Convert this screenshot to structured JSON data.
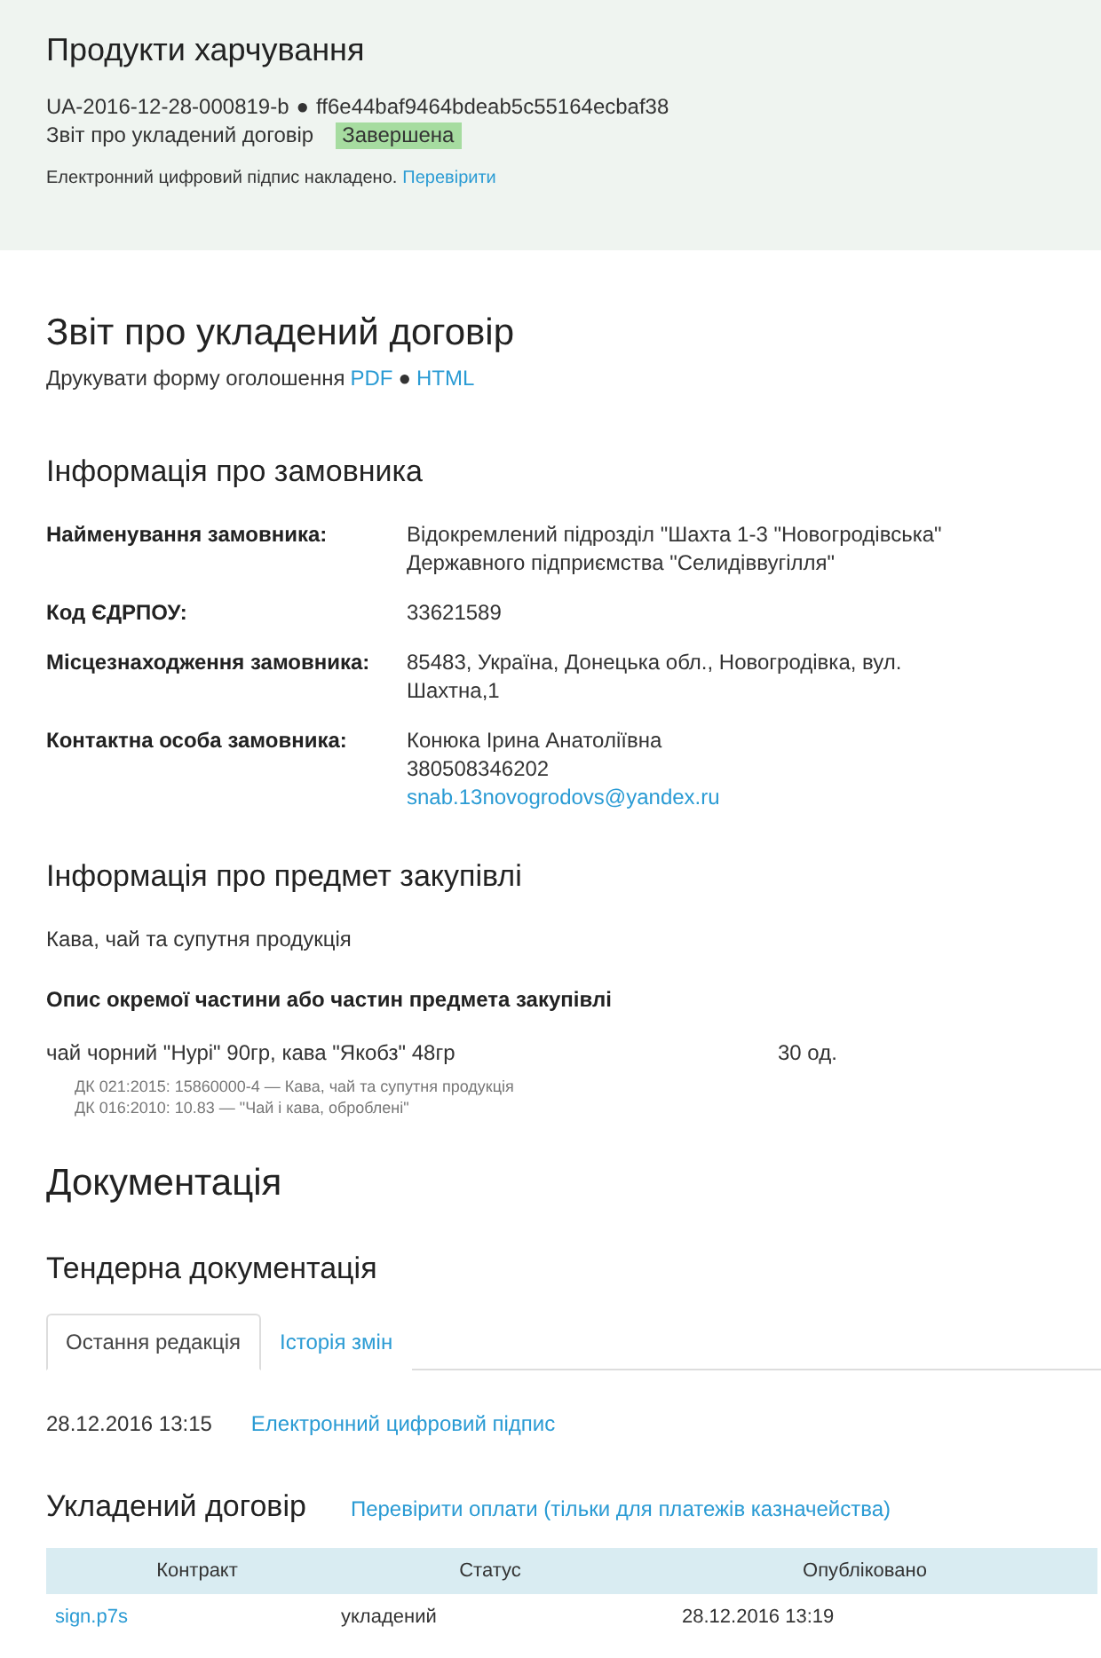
{
  "header": {
    "title": "Продукти харчування",
    "id": "UA-2016-12-28-000819-b",
    "separator": "●",
    "hash": "ff6e44baf9464bdeab5c55164ecbaf38",
    "type": "Звіт про укладений договір",
    "status": "Завершена",
    "signature_note": "Електронний цифровий підпис накладено.",
    "signature_link": "Перевірити"
  },
  "report": {
    "title": "Звіт про укладений договір",
    "print_label": "Друкувати форму оголошення",
    "print_links": [
      "PDF",
      "HTML"
    ],
    "separator": "●"
  },
  "customer": {
    "title": "Інформація про замовника",
    "rows": [
      {
        "label": "Найменування замовника:",
        "lines": [
          {
            "text": "Відокремлений підрозділ \"Шахта 1-3 \"Новогродівська\"",
            "kind": "text"
          },
          {
            "text": "Державного підприємства \"Селидіввугілля\"",
            "kind": "text"
          }
        ]
      },
      {
        "label": "Код ЄДРПОУ:",
        "lines": [
          {
            "text": "33621589",
            "kind": "text"
          }
        ]
      },
      {
        "label": "Місцезнаходження замовника:",
        "lines": [
          {
            "text": "85483, Україна, Донецька обл., Новогродівка, вул.",
            "kind": "text"
          },
          {
            "text": "Шахтна,1",
            "kind": "text"
          }
        ]
      },
      {
        "label": "Контактна особа замовника:",
        "lines": [
          {
            "text": "Конюка Ірина Анатоліївна",
            "kind": "text"
          },
          {
            "text": "380508346202",
            "kind": "text"
          },
          {
            "text": "snab.13novogrodovs@yandex.ru",
            "kind": "link"
          }
        ]
      }
    ]
  },
  "subject": {
    "title": "Інформація про предмет закупівлі",
    "description": "Кава, чай та супутня продукція",
    "lots_title": "Опис окремої частини або частин предмета закупівлі",
    "items": [
      {
        "name": "чай чорний \"Нурі\" 90гр, кава \"Якобз\" 48гр",
        "quantity": "30 од.",
        "codes": [
          "ДК 021:2015: 15860000-4 — Кава, чай та супутня продукція",
          "ДК 016:2010: 10.83 — \"Чай і кава, оброблені\""
        ]
      }
    ]
  },
  "documentation": {
    "title": "Документація",
    "tender_title": "Тендерна документація",
    "tabs": [
      {
        "label": "Остання редакція",
        "selected": true
      },
      {
        "label": "Історія змін",
        "selected": false
      }
    ],
    "documents": [
      {
        "date": "28.12.2016 13:15",
        "link": "Електронний цифровий підпис"
      }
    ]
  },
  "contract": {
    "title": "Укладений договір",
    "payments_link": "Перевірити оплати (тільки для платежів казначейства)",
    "columns": [
      "Контракт",
      "Статус",
      "Опубліковано"
    ],
    "rows": [
      {
        "file": "sign.p7s",
        "status": "укладений",
        "published": "28.12.2016 13:19"
      }
    ]
  }
}
